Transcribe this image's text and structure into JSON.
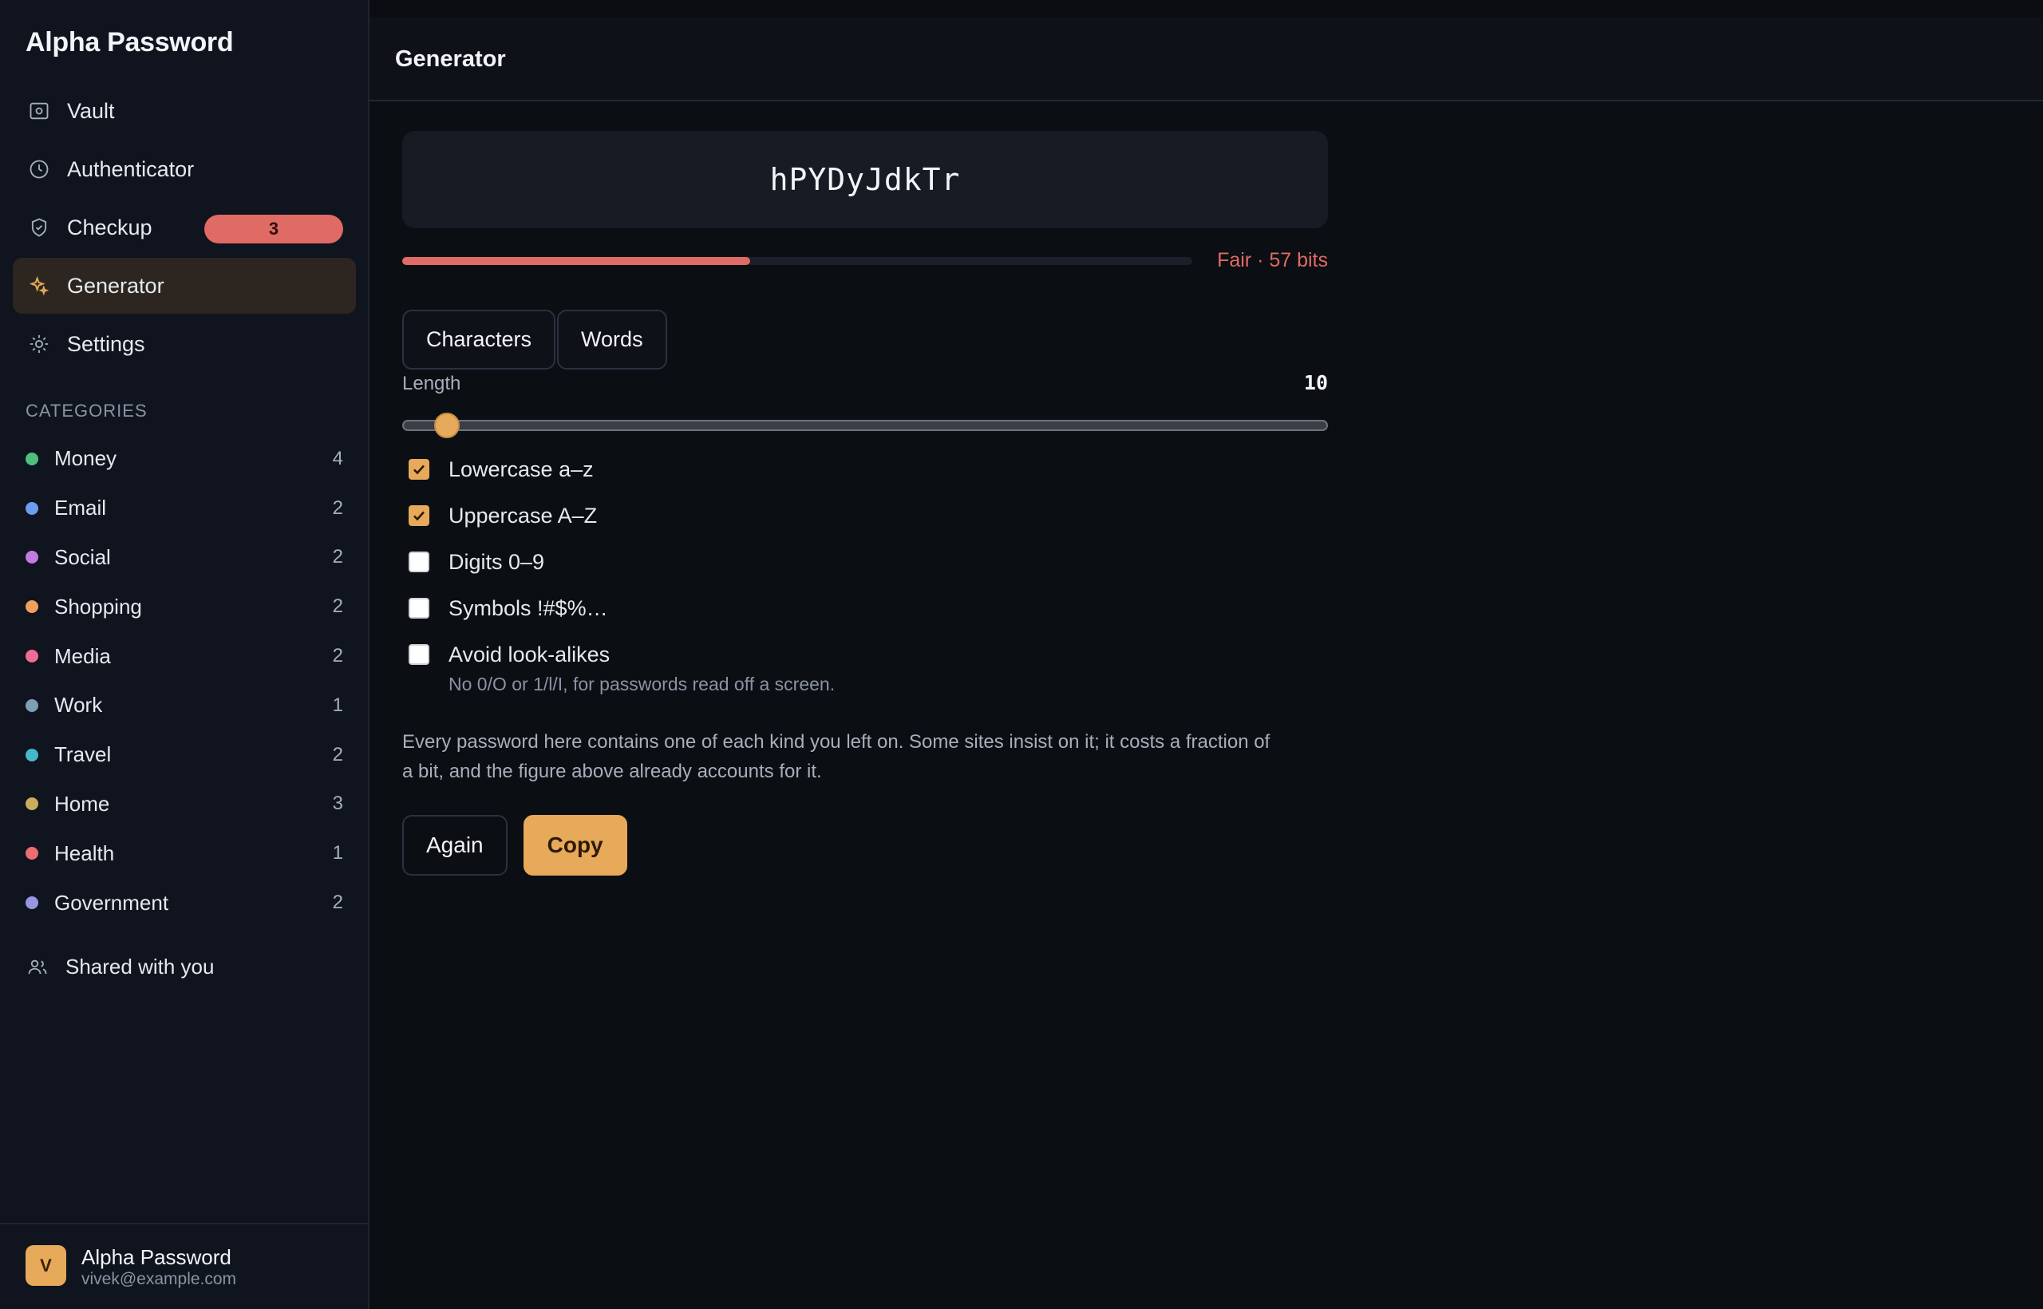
{
  "app": {
    "title": "Alpha Password"
  },
  "nav": {
    "items": [
      {
        "label": "Vault",
        "icon": "vault-icon"
      },
      {
        "label": "Authenticator",
        "icon": "clock-icon"
      },
      {
        "label": "Checkup",
        "icon": "shield-icon",
        "badge": "3"
      },
      {
        "label": "Generator",
        "icon": "sparkle-icon",
        "active": true
      },
      {
        "label": "Settings",
        "icon": "gear-icon"
      }
    ]
  },
  "categories": {
    "heading": "CATEGORIES",
    "items": [
      {
        "label": "Money",
        "count": "4",
        "color": "#4fbf7f"
      },
      {
        "label": "Email",
        "count": "2",
        "color": "#6b9cf0"
      },
      {
        "label": "Social",
        "count": "2",
        "color": "#c27be0"
      },
      {
        "label": "Shopping",
        "count": "2",
        "color": "#f0a05a"
      },
      {
        "label": "Media",
        "count": "2",
        "color": "#ee6b9a"
      },
      {
        "label": "Work",
        "count": "1",
        "color": "#7f9fb6"
      },
      {
        "label": "Travel",
        "count": "2",
        "color": "#47b8c9"
      },
      {
        "label": "Home",
        "count": "3",
        "color": "#c9ad5e"
      },
      {
        "label": "Health",
        "count": "1",
        "color": "#ec6d6d"
      },
      {
        "label": "Government",
        "count": "2",
        "color": "#9a95e0"
      }
    ]
  },
  "shared": {
    "label": "Shared with you"
  },
  "account": {
    "initial": "V",
    "name": "Alpha Password",
    "email": "vivek@example.com"
  },
  "header": {
    "title": "Generator"
  },
  "generator": {
    "password": "hPYDyJdkTr",
    "strength_label": "Fair · 57 bits",
    "strength_fraction": 0.44,
    "strength_color": "#e06b64",
    "mode_tabs": [
      "Characters",
      "Words"
    ],
    "length_label": "Length",
    "length_value": "10",
    "length_min": 8,
    "length_max": 64,
    "options": [
      {
        "label": "Lowercase a–z",
        "checked": true
      },
      {
        "label": "Uppercase A–Z",
        "checked": true
      },
      {
        "label": "Digits 0–9",
        "checked": false
      },
      {
        "label": "Symbols !#$%…",
        "checked": false
      },
      {
        "label": "Avoid look-alikes",
        "checked": false,
        "hint": "No 0/O or 1/l/I, for passwords read off a screen."
      }
    ],
    "note": "Every password here contains one of each kind you left on. Some sites insist on it; it costs a fraction of a bit, and the figure above already accounts for it.",
    "again_label": "Again",
    "copy_label": "Copy",
    "accent": "#e7a95a"
  }
}
